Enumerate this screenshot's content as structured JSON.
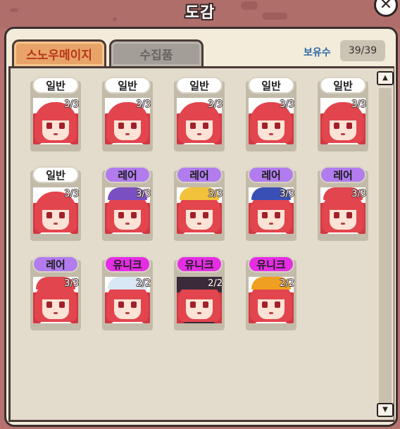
{
  "window": {
    "title": "도감",
    "close_label": "✕"
  },
  "tabs": [
    {
      "label": "스노우메이지",
      "active": true
    },
    {
      "label": "수집품",
      "active": false
    }
  ],
  "owned": {
    "label": "보유수",
    "value": "39/39"
  },
  "scrollbar": {
    "up": "▲",
    "down": "▼"
  },
  "colors": {
    "normal_badge": "#ffffff",
    "rare_badge": "#b27cef",
    "unique_badge": "#e52de4",
    "active_tab_text": "#b8361c",
    "owned_label": "#2f6aa8"
  },
  "items": [
    {
      "rarity": "일반",
      "count": "3/3",
      "variant": "normal"
    },
    {
      "rarity": "일반",
      "count": "3/3",
      "variant": "normal"
    },
    {
      "rarity": "일반",
      "count": "3/3",
      "variant": "normal"
    },
    {
      "rarity": "일반",
      "count": "3/3",
      "variant": "normal"
    },
    {
      "rarity": "일반",
      "count": "3/3",
      "variant": "normal"
    },
    {
      "rarity": "일반",
      "count": "3/3",
      "variant": "normal"
    },
    {
      "rarity": "레어",
      "count": "3/3",
      "variant": "rare"
    },
    {
      "rarity": "레어",
      "count": "3/3",
      "variant": "rare"
    },
    {
      "rarity": "레어",
      "count": "3/3",
      "variant": "rare"
    },
    {
      "rarity": "레어",
      "count": "3/3",
      "variant": "rare"
    },
    {
      "rarity": "레어",
      "count": "3/3",
      "variant": "rare"
    },
    {
      "rarity": "유니크",
      "count": "2/2",
      "variant": "unique"
    },
    {
      "rarity": "유니크",
      "count": "2/2",
      "variant": "unique"
    },
    {
      "rarity": "유니크",
      "count": "2/2",
      "variant": "unique"
    }
  ]
}
